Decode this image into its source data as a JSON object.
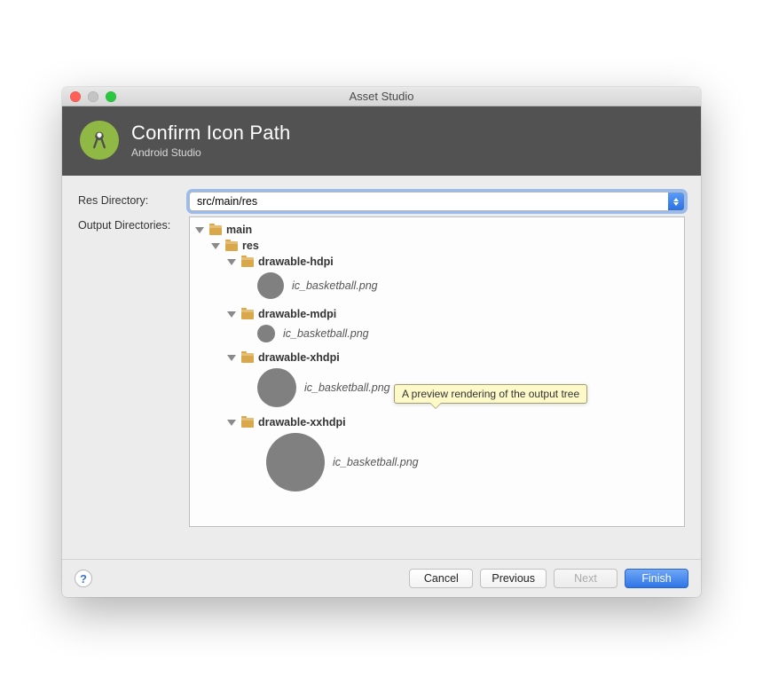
{
  "window_title": "Asset Studio",
  "header": {
    "title": "Confirm Icon Path",
    "subtitle": "Android Studio"
  },
  "labels": {
    "res_dir": "Res Directory:",
    "output_dirs": "Output Directories:"
  },
  "res_dir_value": "src/main/res",
  "tree": {
    "root": "main",
    "res": "res",
    "folders": [
      {
        "name": "drawable-hdpi",
        "file": "ic_basketball.png",
        "size": 30,
        "indent": 72
      },
      {
        "name": "drawable-mdpi",
        "file": "ic_basketball.png",
        "size": 20,
        "indent": 72
      },
      {
        "name": "drawable-xhdpi",
        "file": "ic_basketball.png",
        "size": 44,
        "indent": 72
      },
      {
        "name": "drawable-xxhdpi",
        "file": "ic_basketball.png",
        "size": 66,
        "indent": 82
      }
    ]
  },
  "tooltip_text": "A preview rendering of the output tree",
  "footer": {
    "cancel": "Cancel",
    "previous": "Previous",
    "next": "Next",
    "finish": "Finish"
  }
}
